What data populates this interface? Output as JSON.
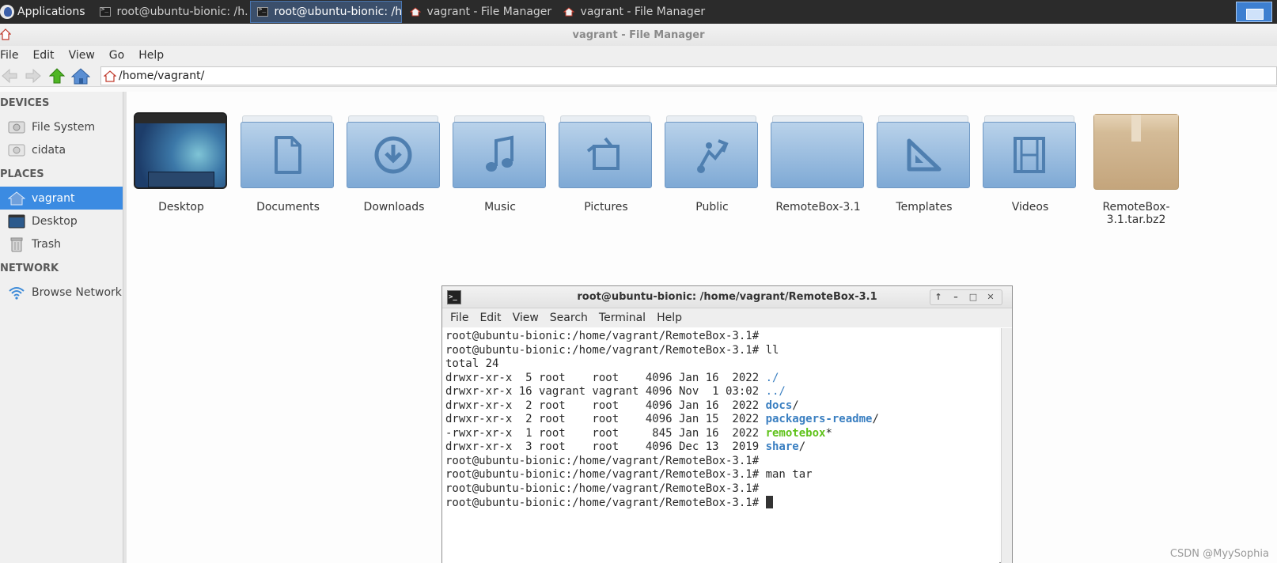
{
  "taskbar": {
    "app_menu_label": "Applications",
    "tasks": [
      {
        "label": "root@ubuntu-bionic: /h...",
        "type": "terminal",
        "active": false
      },
      {
        "label": "root@ubuntu-bionic: /h...",
        "type": "terminal",
        "active": true
      },
      {
        "label": "vagrant - File Manager",
        "type": "home",
        "active": false
      },
      {
        "label": "vagrant - File Manager",
        "type": "home",
        "active": false
      }
    ]
  },
  "file_manager": {
    "title": "vagrant - File Manager",
    "menu": [
      "File",
      "Edit",
      "View",
      "Go",
      "Help"
    ],
    "toolbar": {
      "buttons": [
        "back-icon",
        "forward-icon",
        "up-icon",
        "home-icon"
      ]
    },
    "location": "/home/vagrant/",
    "sidebar": {
      "devices_label": "DEVICES",
      "devices": [
        {
          "label": "File System",
          "icon": "drive-icon"
        },
        {
          "label": "cidata",
          "icon": "drive-icon"
        }
      ],
      "places_label": "PLACES",
      "places": [
        {
          "label": "vagrant",
          "icon": "home-icon",
          "selected": true
        },
        {
          "label": "Desktop",
          "icon": "desktop-icon"
        },
        {
          "label": "Trash",
          "icon": "trash-icon"
        }
      ],
      "network_label": "NETWORK",
      "network": [
        {
          "label": "Browse Network",
          "icon": "wifi-icon"
        }
      ]
    },
    "items": [
      {
        "name": "Desktop",
        "kind": "desktop"
      },
      {
        "name": "Documents",
        "kind": "folder",
        "glyph": "document"
      },
      {
        "name": "Downloads",
        "kind": "folder",
        "glyph": "download"
      },
      {
        "name": "Music",
        "kind": "folder",
        "glyph": "music"
      },
      {
        "name": "Pictures",
        "kind": "folder",
        "glyph": "pictures"
      },
      {
        "name": "Public",
        "kind": "folder",
        "glyph": "share"
      },
      {
        "name": "RemoteBox-3.1",
        "kind": "folder",
        "glyph": "none"
      },
      {
        "name": "Templates",
        "kind": "folder",
        "glyph": "templates"
      },
      {
        "name": "Videos",
        "kind": "folder",
        "glyph": "video"
      },
      {
        "name": "RemoteBox-3.1.tar.bz2",
        "kind": "archive"
      }
    ]
  },
  "terminal": {
    "title": "root@ubuntu-bionic: /home/vagrant/RemoteBox-3.1",
    "menu": [
      "File",
      "Edit",
      "View",
      "Search",
      "Terminal",
      "Help"
    ],
    "lines": [
      {
        "text": "root@ubuntu-bionic:/home/vagrant/RemoteBox-3.1#"
      },
      {
        "text": "root@ubuntu-bionic:/home/vagrant/RemoteBox-3.1# ll"
      },
      {
        "text": "total 24"
      },
      {
        "text": "drwxr-xr-x  5 root    root    4096 Jan 16  2022 ",
        "name": "./",
        "style": "dir",
        "suffix": ""
      },
      {
        "text": "drwxr-xr-x 16 vagrant vagrant 4096 Nov  1 03:02 ",
        "name": "../",
        "style": "dir",
        "suffix": ""
      },
      {
        "text": "drwxr-xr-x  2 root    root    4096 Jan 16  2022 ",
        "name": "docs",
        "style": "dirb",
        "suffix": "/"
      },
      {
        "text": "drwxr-xr-x  2 root    root    4096 Jan 15  2022 ",
        "name": "packagers-readme",
        "style": "dirb",
        "suffix": "/"
      },
      {
        "text": "-rwxr-xr-x  1 root    root     845 Jan 16  2022 ",
        "name": "remotebox",
        "style": "exe",
        "suffix": "*"
      },
      {
        "text": "drwxr-xr-x  3 root    root    4096 Dec 13  2019 ",
        "name": "share",
        "style": "dirb",
        "suffix": "/"
      },
      {
        "text": "root@ubuntu-bionic:/home/vagrant/RemoteBox-3.1#"
      },
      {
        "text": "root@ubuntu-bionic:/home/vagrant/RemoteBox-3.1# man tar"
      },
      {
        "text": "root@ubuntu-bionic:/home/vagrant/RemoteBox-3.1#"
      },
      {
        "text": "root@ubuntu-bionic:/home/vagrant/RemoteBox-3.1# ",
        "cursor": true
      }
    ]
  },
  "watermark": "CSDN @MyySophia",
  "colors": {
    "selection": "#3b8be2",
    "folder": "#8fb5dc",
    "term_dir": "#3a7fc1",
    "term_exec": "#5fc21a"
  }
}
